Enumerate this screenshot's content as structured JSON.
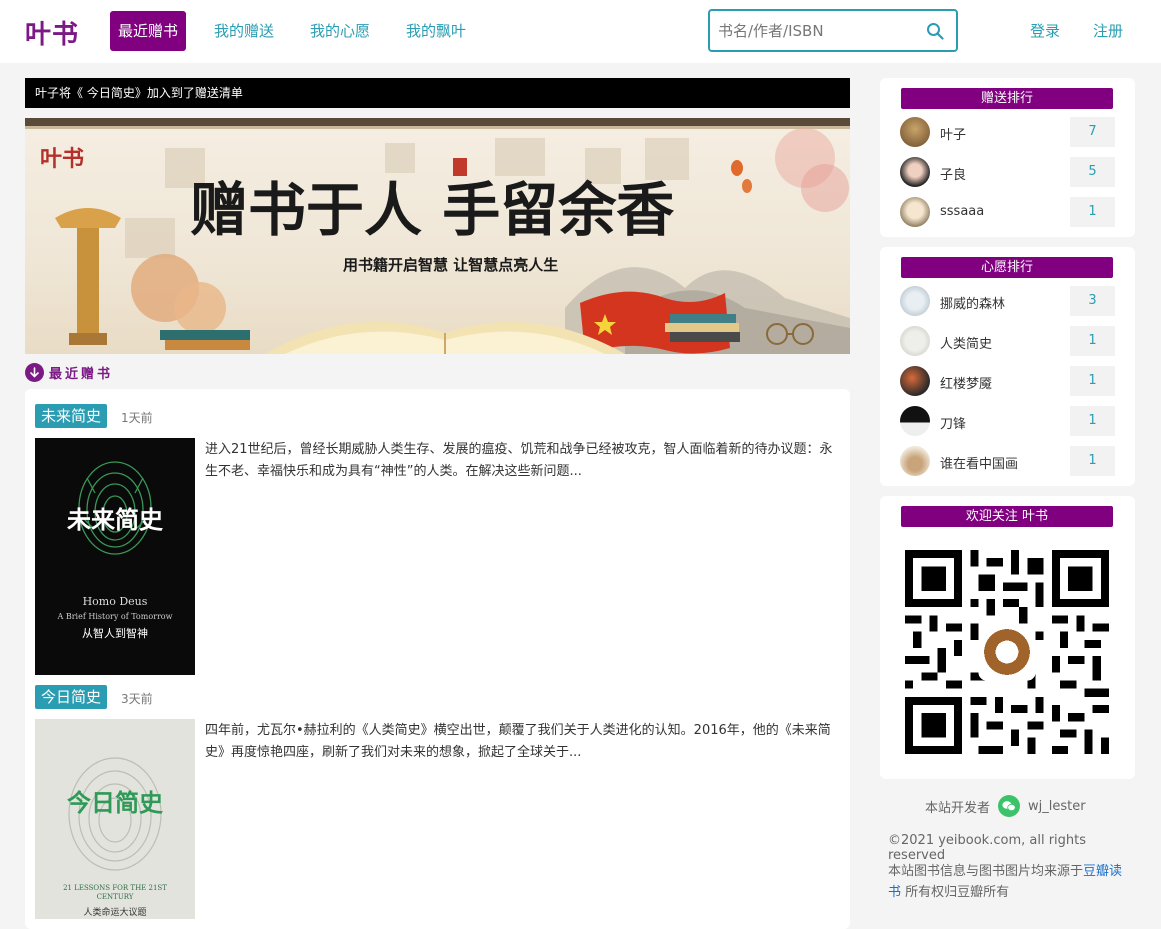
{
  "nav": {
    "logo": "叶书",
    "items": [
      "最近赠书",
      "我的赠送",
      "我的心愿",
      "我的飘叶"
    ],
    "search_placeholder": "书名/作者/ISBN",
    "login": "登录",
    "register": "注册"
  },
  "marquee": "叶子将《 今日简史》加入到了赠送清单",
  "banner": {
    "logo_text": "叶书",
    "headline": "赠书于人 手留余香",
    "subline": "用书籍开启智慧   让智慧点亮人生"
  },
  "section_title": "最近赠书",
  "books": [
    {
      "title": "未来简史",
      "time": "1天前",
      "cover_title": "未来简史",
      "cover_en": "Homo Deus",
      "cover_en_sub": "A Brief History of Tomorrow",
      "cover_sub": "从智人到智神",
      "desc": "进入21世纪后，曾经长期威胁人类生存、发展的瘟疫、饥荒和战争已经被攻克，智人面临着新的待办议题：永生不老、幸福快乐和成为具有“神性”的人类。在解决这些新问题..."
    },
    {
      "title": "今日简史",
      "time": "3天前",
      "cover_title": "今日简史",
      "cover_en": "21 LESSONS FOR THE 21ST CENTURY",
      "cover_sub": "人类命运大议题",
      "desc": "四年前，尤瓦尔•赫拉利的《人类简史》横空出世，颠覆了我们关于人类进化的认知。2016年，他的《未来简史》再度惊艳四座，刷新了我们对未来的想象，掀起了全球关于..."
    }
  ],
  "donate_rank": {
    "title": "赠送排行",
    "items": [
      {
        "name": "叶子",
        "count": "7"
      },
      {
        "name": "子良",
        "count": "5"
      },
      {
        "name": "sssaaa",
        "count": "1"
      }
    ]
  },
  "wish_rank": {
    "title": "心愿排行",
    "items": [
      {
        "name": "挪威的森林",
        "count": "3"
      },
      {
        "name": "人类简史",
        "count": "1"
      },
      {
        "name": "红楼梦魇",
        "count": "1"
      },
      {
        "name": "刀锋",
        "count": "1"
      },
      {
        "name": "谁在看中国画",
        "count": "1"
      }
    ]
  },
  "follow": {
    "title": "欢迎关注 叶书"
  },
  "footer": {
    "dev_label": "本站开发者",
    "dev_wechat": "wj_lester",
    "copyright": "©2021 yeibook.com, all rights reserved",
    "source_prefix": "本站图书信息与图书图片均来源于",
    "source_link": "豆瓣读书",
    "source_suffix": " 所有权归豆瓣所有"
  }
}
